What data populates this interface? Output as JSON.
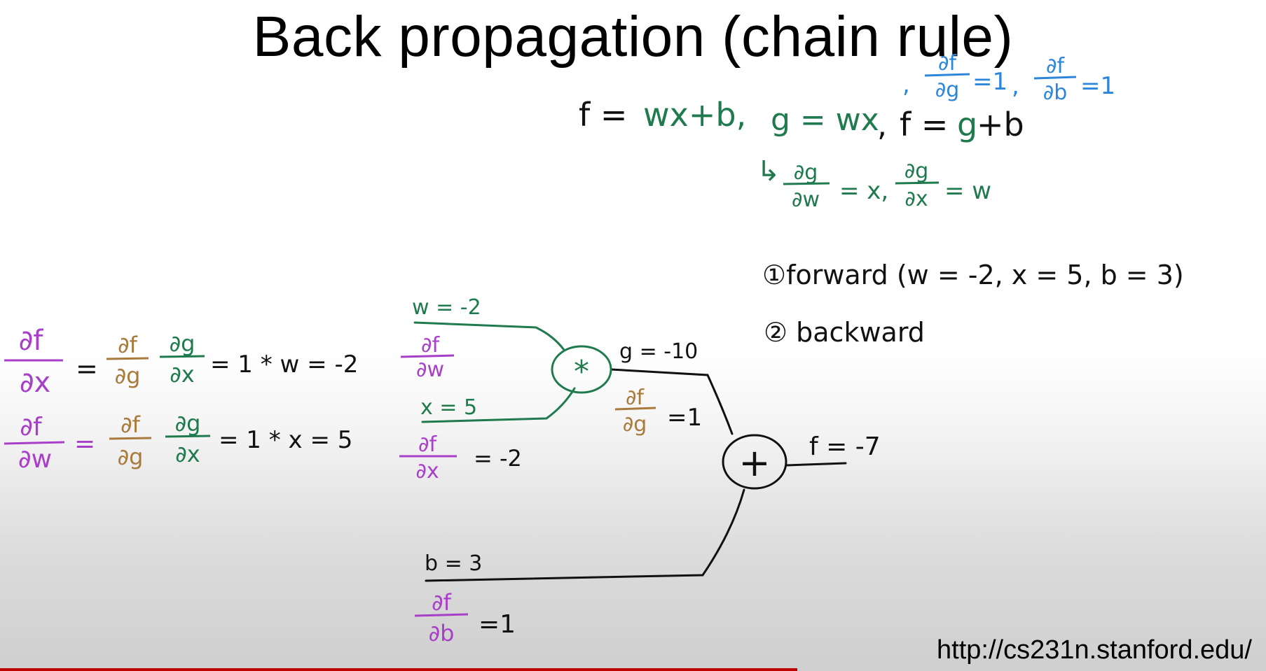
{
  "title": "Back propagation (chain rule)",
  "url": "http://cs231n.stanford.edu/",
  "playback_progress": 0.63,
  "colors": {
    "ink": "#111111",
    "green": "#1f7a4d",
    "purple": "#a83fc8",
    "brown": "#a87a3c",
    "blue": "#2d86d9",
    "progress": "#c00000"
  },
  "board": {
    "eq_f": "f =",
    "eq_wx_b": "wx+b,",
    "eq_g": "g = wx",
    "eq_comma": ",",
    "eq_f2": "f = ",
    "eq_g2": "g",
    "eq_plus_b": "+b",
    "blue_lead": ",",
    "df_num": "∂f",
    "dg_den": "∂g",
    "db_den": "∂b",
    "eq1": "=1",
    "sep": ",",
    "hook": "↳",
    "dg_num": "∂g",
    "dw_den": "∂w",
    "dx_den": "∂x",
    "eq_x": "= x,",
    "eq_w": "= w",
    "step1": "①forward (w = -2, x = 5, b = 3)",
    "step2": "② backward",
    "w_val": "w = -2",
    "x_val": "x = 5",
    "b_val": "b = 3",
    "g_val": "g = -10",
    "f_val": "f = -7",
    "mult_op": "*",
    "plus_op": "+",
    "eq_neg2": "= -2",
    "left_eq": "=",
    "left1_mid": "= 1 * w = -2",
    "left2_mid": "= 1 * x = 5"
  }
}
